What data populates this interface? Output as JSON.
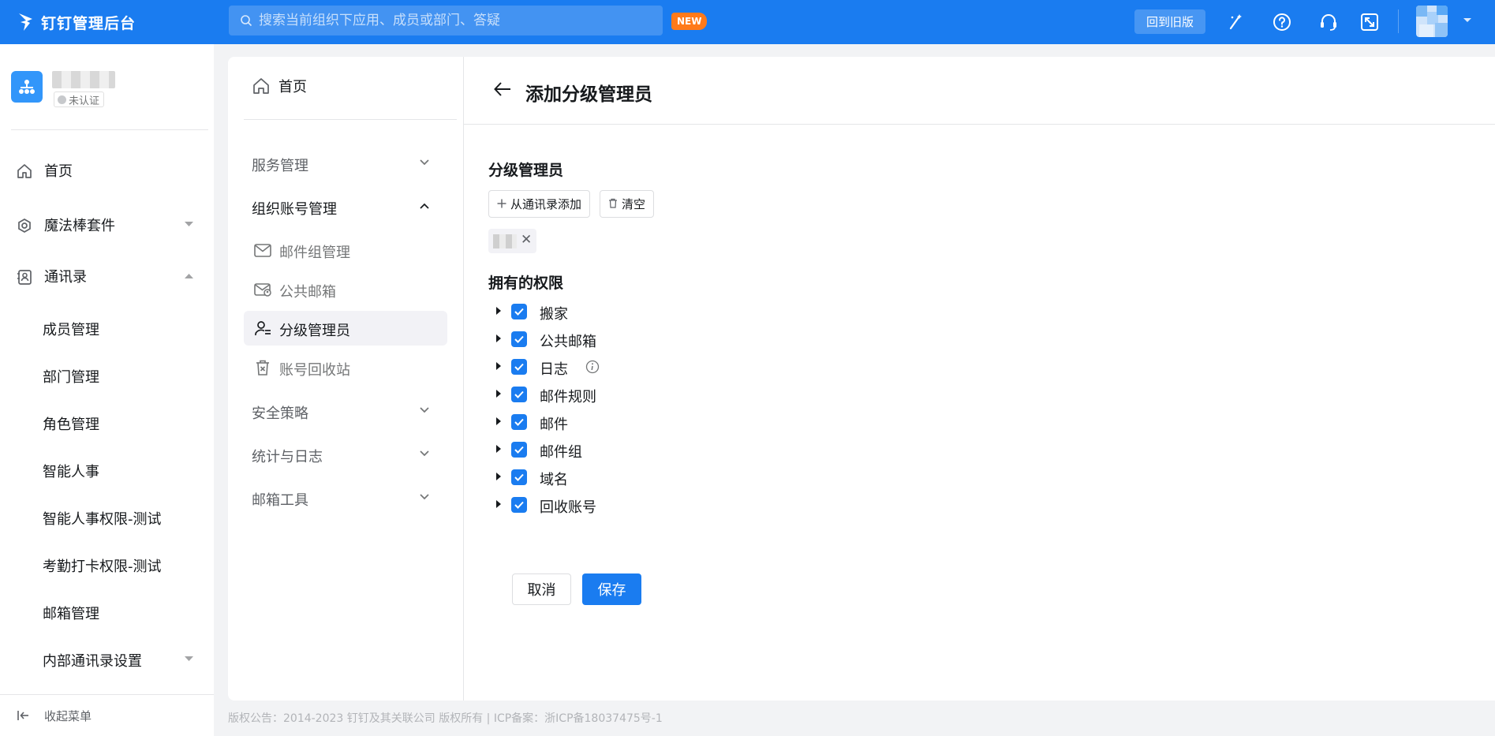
{
  "topbar": {
    "brand_title": "钉钉管理后台",
    "search_placeholder": "搜索当前组织下应用、成员或部门、答疑",
    "new_badge": "NEW",
    "old_version_button": "回到旧版",
    "colors": {
      "bar": "#1a7cf0",
      "badge": "#ff7a1a"
    },
    "icons": [
      "magic-wand-icon",
      "help-icon",
      "headset-icon",
      "fullscreen-icon",
      "chevron-down-icon"
    ]
  },
  "sidebar": {
    "org_status": "未认证",
    "items": [
      {
        "label": "首页",
        "icon": "home-icon"
      },
      {
        "label": "魔法棒套件",
        "icon": "magic-icon",
        "expandable": true
      },
      {
        "label": "通讯录",
        "icon": "contacts-icon",
        "expanded": true
      }
    ],
    "sub_items": [
      "成员管理",
      "部门管理",
      "角色管理",
      "智能人事",
      "智能人事权限-测试",
      "考勤打卡权限-测试",
      "邮箱管理",
      "内部通讯录设置"
    ],
    "collapse_label": "收起菜单"
  },
  "subnav": {
    "home": "首页",
    "groups": [
      {
        "label": "服务管理",
        "expanded": false
      },
      {
        "label": "组织账号管理",
        "expanded": true
      },
      {
        "label": "安全策略",
        "expanded": false
      },
      {
        "label": "统计与日志",
        "expanded": false
      },
      {
        "label": "邮箱工具",
        "expanded": false
      }
    ],
    "items": [
      {
        "label": "邮件组管理",
        "icon": "mail-icon"
      },
      {
        "label": "公共邮箱",
        "icon": "shared-mailbox-icon"
      },
      {
        "label": "分级管理员",
        "icon": "admin-user-icon",
        "active": true
      },
      {
        "label": "账号回收站",
        "icon": "trash-icon"
      }
    ]
  },
  "content": {
    "title": "添加分级管理员",
    "admin_section_title": "分级管理员",
    "add_from_contacts": "从通讯录添加",
    "clear": "清空",
    "permissions_title": "拥有的权限",
    "permissions": [
      {
        "label": "搬家",
        "checked": true
      },
      {
        "label": "公共邮箱",
        "checked": true
      },
      {
        "label": "日志",
        "checked": true,
        "info": true
      },
      {
        "label": "邮件规则",
        "checked": true
      },
      {
        "label": "邮件",
        "checked": true
      },
      {
        "label": "邮件组",
        "checked": true
      },
      {
        "label": "域名",
        "checked": true
      },
      {
        "label": "回收账号",
        "checked": true
      }
    ],
    "cancel": "取消",
    "save": "保存"
  },
  "footer": "版权公告：2014-2023 钉钉及其关联公司 版权所有 | ICP备案：浙ICP备18037475号-1"
}
